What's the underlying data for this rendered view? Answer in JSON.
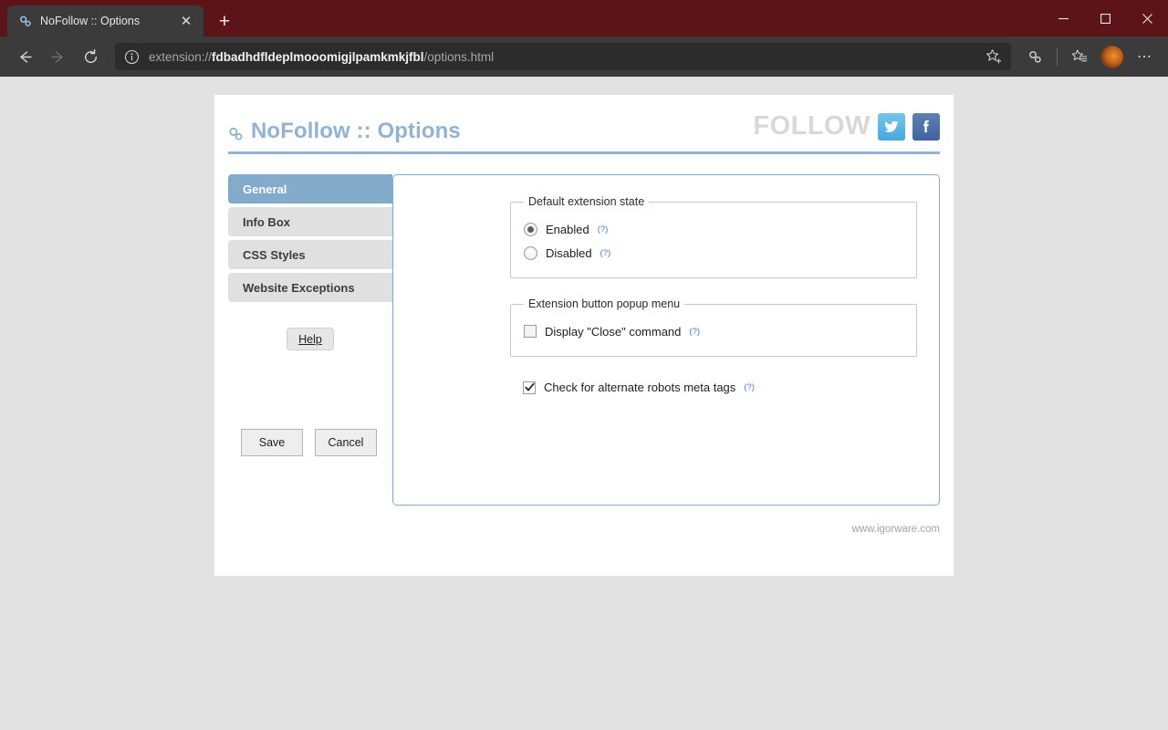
{
  "browser": {
    "tab": {
      "title": "NoFollow :: Options",
      "favicon": "link-chain-icon",
      "close_label": "✕"
    },
    "new_tab_label": "+",
    "window_controls": {
      "minimize": "—",
      "maximize": "□",
      "close": "✕"
    },
    "nav": {
      "back": "←",
      "forward": "→",
      "reload": "↻"
    },
    "omnibox": {
      "info_icon": "info-circle-icon",
      "url_prefix": "extension://",
      "url_host": "fdbadhdfldeplmooomigjlpamkmkjfbl",
      "url_path": "/options.html",
      "full_url": "extension://fdbadhdfldeplmooomigjlpamkmkjfbl/options.html",
      "star_icon": "add-favorite-star-icon"
    },
    "toolbar_icons": [
      "extensions-icon",
      "favorites-list-icon",
      "profile-avatar",
      "more-menu-icon"
    ],
    "more_menu_label": "⋯",
    "colors": {
      "titlebar": "#5c1418",
      "toolbar": "#3b3b3b",
      "omnibox": "#2c2c2c"
    }
  },
  "page": {
    "title": "NoFollow :: Options",
    "title_icon": "link-chain-icon",
    "follow_label": "FOLLOW",
    "social": [
      {
        "name": "twitter",
        "glyph": "twitter-bird-icon",
        "color": "#5ab9e8"
      },
      {
        "name": "facebook",
        "glyph": "facebook-f-icon",
        "color": "#4a6ea9"
      }
    ],
    "accent_color": "#81aacb",
    "sidebar": {
      "tabs": [
        {
          "label": "General",
          "active": true
        },
        {
          "label": "Info Box",
          "active": false
        },
        {
          "label": "CSS Styles",
          "active": false
        },
        {
          "label": "Website Exceptions",
          "active": false
        }
      ],
      "help_label": "Help",
      "save_label": "Save",
      "cancel_label": "Cancel"
    },
    "general": {
      "state_fieldset": {
        "legend": "Default extension state",
        "options": [
          {
            "label": "Enabled",
            "selected": true,
            "help": "(?)"
          },
          {
            "label": "Disabled",
            "selected": false,
            "help": "(?)"
          }
        ]
      },
      "popup_fieldset": {
        "legend": "Extension button popup menu",
        "options": [
          {
            "label": "Display \"Close\" command",
            "checked": false,
            "help": "(?)"
          }
        ]
      },
      "robots_checkbox": {
        "label": "Check for alternate robots meta tags",
        "checked": true,
        "help": "(?)"
      }
    },
    "footer": "www.igorware.com"
  }
}
